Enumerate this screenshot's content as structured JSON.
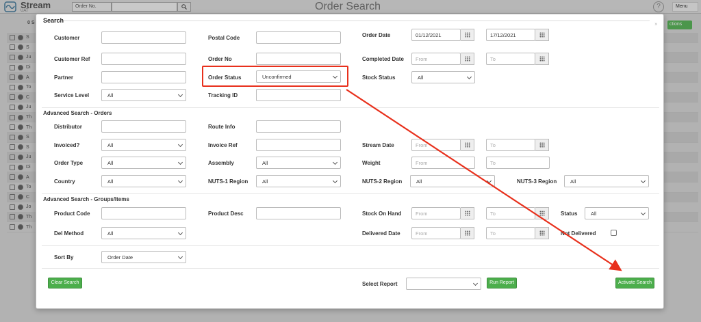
{
  "app": {
    "name": "Stream",
    "env": "UAT",
    "page_title": "Order Search"
  },
  "topbar": {
    "search_type": "Order No.",
    "help": "?",
    "menu": "Menu"
  },
  "background": {
    "header_label": "0 S",
    "actions_label": "ctions",
    "row_labels": [
      "S",
      "S",
      "Ju",
      "Di",
      "A",
      "To",
      "C",
      "Ju",
      "Th",
      "Th",
      "S",
      "S",
      "Ju",
      "Di",
      "A",
      "To",
      "C",
      "Jo",
      "Th",
      "Th"
    ]
  },
  "modal": {
    "title": "Search",
    "close": "×",
    "labels": {
      "customer": "Customer",
      "postal_code": "Postal Code",
      "order_date": "Order Date",
      "customer_ref": "Customer Ref",
      "order_no": "Order No",
      "completed_date": "Completed Date",
      "partner": "Partner",
      "order_status": "Order Status",
      "stock_status": "Stock Status",
      "service_level": "Service Level",
      "tracking_id": "Tracking ID",
      "distributor": "Distributor",
      "route_info": "Route Info",
      "invoiced": "Invoiced?",
      "invoice_ref": "Invoice Ref",
      "stream_date": "Stream Date",
      "order_type": "Order Type",
      "assembly": "Assembly",
      "weight": "Weight",
      "country": "Country",
      "nuts1": "NUTS-1 Region",
      "nuts2": "NUTS-2 Region",
      "nuts3": "NUTS-3 Region",
      "product_code": "Product Code",
      "product_desc": "Product Desc",
      "stock_on_hand": "Stock On Hand",
      "status": "Status",
      "del_method": "Del Method",
      "delivered_date": "Delivered Date",
      "not_delivered": "Not Delivered",
      "sort_by": "Sort By",
      "select_report": "Select Report"
    },
    "sections": {
      "orders": "Advanced Search - Orders",
      "groups": "Advanced Search - Groups/Items"
    },
    "values": {
      "order_date_from": "01/12/2021",
      "order_date_to": "17/12/2021",
      "order_status": "Unconfirmed",
      "stock_status": "All",
      "service_level": "All",
      "invoiced": "All",
      "order_type": "All",
      "assembly": "All",
      "country": "All",
      "nuts1": "All",
      "nuts2": "All",
      "nuts3": "All",
      "status": "All",
      "del_method": "All",
      "sort_by": "Order Date"
    },
    "placeholders": {
      "from": "From",
      "to": "To"
    },
    "buttons": {
      "clear": "Clear Search",
      "run_report": "Run Report",
      "activate": "Activate Search"
    }
  },
  "colors": {
    "highlight": "#e8301c",
    "button_green": "#4cae4c"
  }
}
